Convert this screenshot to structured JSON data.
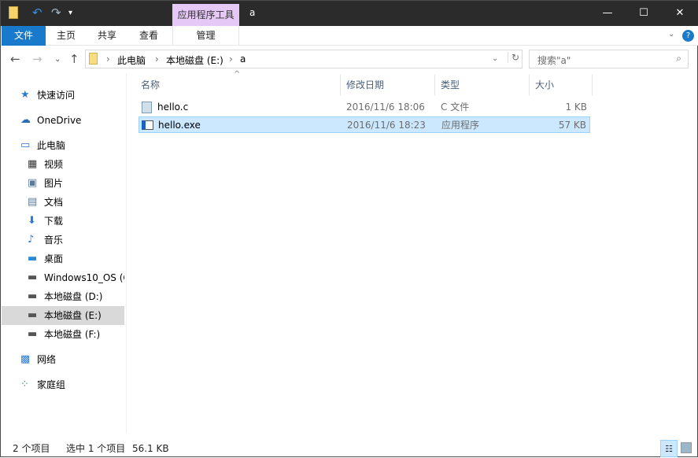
{
  "title_bar": {
    "context_tab": "应用程序工具",
    "window_title": "a",
    "minimize": "—",
    "maximize": "☐",
    "close": "✕"
  },
  "ribbon": {
    "tabs": [
      {
        "label": "文件"
      },
      {
        "label": "主页"
      },
      {
        "label": "共享"
      },
      {
        "label": "查看"
      },
      {
        "label": "管理"
      }
    ]
  },
  "address": {
    "crumbs": [
      "此电脑",
      "本地磁盘 (E:)",
      "a"
    ]
  },
  "search": {
    "placeholder": "搜索\"a\""
  },
  "sidebar": {
    "items": [
      {
        "label": "快速访问",
        "icon": "star-icon"
      },
      {
        "label": "OneDrive",
        "icon": "cloud-icon"
      },
      {
        "label": "此电脑",
        "icon": "computer-icon"
      },
      {
        "label": "视频",
        "icon": "video-icon"
      },
      {
        "label": "图片",
        "icon": "picture-icon"
      },
      {
        "label": "文档",
        "icon": "document-icon"
      },
      {
        "label": "下载",
        "icon": "download-icon"
      },
      {
        "label": "音乐",
        "icon": "music-icon"
      },
      {
        "label": "桌面",
        "icon": "desktop-icon"
      },
      {
        "label": "Windows10_OS (C",
        "icon": "drive-icon"
      },
      {
        "label": "本地磁盘 (D:)",
        "icon": "drive-icon"
      },
      {
        "label": "本地磁盘 (E:)",
        "icon": "drive-icon",
        "selected": true
      },
      {
        "label": "本地磁盘 (F:)",
        "icon": "drive-icon"
      },
      {
        "label": "网络",
        "icon": "network-icon"
      },
      {
        "label": "家庭组",
        "icon": "homegroup-icon"
      }
    ]
  },
  "columns": [
    "名称",
    "修改日期",
    "类型",
    "大小"
  ],
  "files": [
    {
      "name": "hello.c",
      "date": "2016/11/6 18:06",
      "type": "C 文件",
      "size": "1 KB"
    },
    {
      "name": "hello.exe",
      "date": "2016/11/6 18:23",
      "type": "应用程序",
      "size": "57 KB",
      "selected": true
    }
  ],
  "status": {
    "count": "2 个项目",
    "selection": "选中 1 个项目",
    "size": "56.1 KB"
  },
  "colors": {
    "accent": "#1979ca",
    "selection": "#cce8ff",
    "context_tab": "#e5c8f5"
  }
}
